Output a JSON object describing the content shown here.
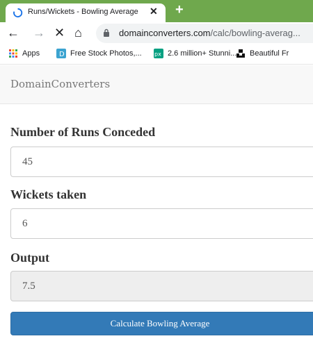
{
  "browser": {
    "tab_title": "Runs/Wickets - Bowling Average",
    "tab_close": "✕",
    "new_tab": "+",
    "url_domain": "domainconverters.com",
    "url_path": "/calc/bowling-averag...",
    "nav": {
      "back": "←",
      "forward": "→",
      "stop": "✕",
      "home": "⌂"
    },
    "bookmarks": [
      {
        "label": "Apps",
        "icon": "apps-grid-icon"
      },
      {
        "label": "Free Stock Photos,...",
        "icon": "pexels-d-icon"
      },
      {
        "label": "2.6 million+ Stunni...",
        "icon": "pixabay-px-icon"
      },
      {
        "label": "Beautiful Fr",
        "icon": "unsplash-icon"
      }
    ]
  },
  "page": {
    "brand": "DomainConverters",
    "fields": [
      {
        "label": "Number of Runs Conceded",
        "value": "45"
      },
      {
        "label": "Wickets taken",
        "value": "6"
      },
      {
        "label": "Output",
        "value": "7.5"
      }
    ],
    "button": "Calculate Bowling Average"
  },
  "colors": {
    "tabstrip": "#6fa84d",
    "button": "#337ab7",
    "output_bg": "#eeeeee"
  }
}
